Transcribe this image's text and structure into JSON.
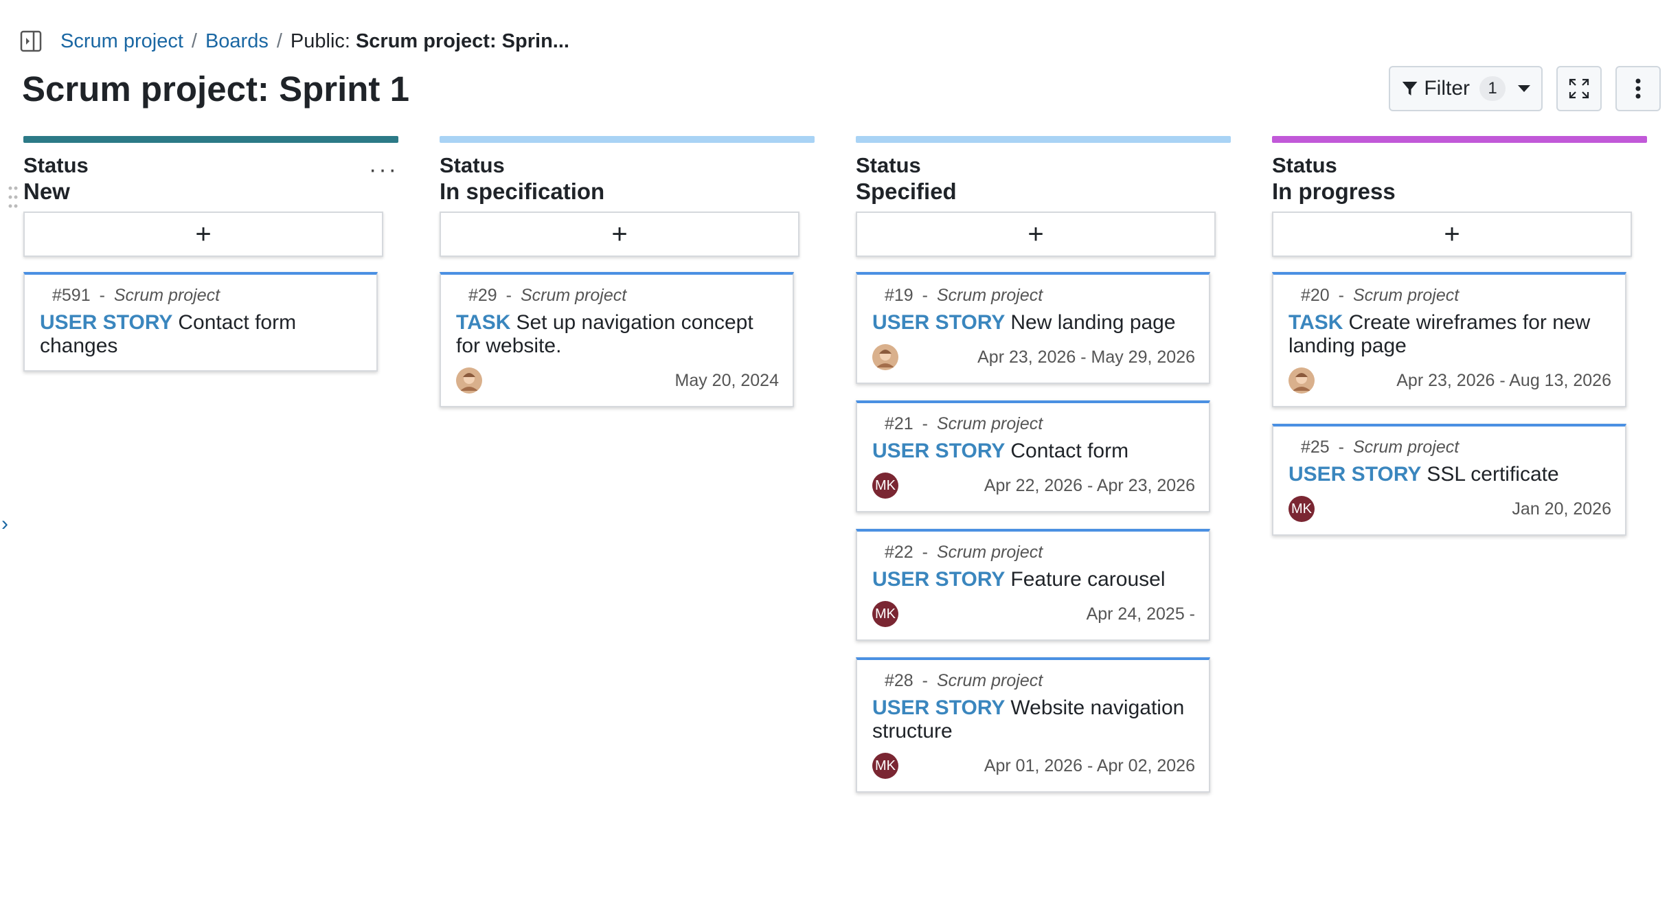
{
  "breadcrumb": {
    "project": "Scrum project",
    "sep1": "/",
    "boards": "Boards",
    "sep2": "/",
    "public_prefix": "Public:",
    "current": "Scrum project: Sprin..."
  },
  "page": {
    "title": "Scrum project: Sprint 1"
  },
  "toolbar": {
    "filter_label": "Filter",
    "filter_count": "1"
  },
  "side_chevron": "›",
  "columns": [
    {
      "status_label": "Status",
      "name": "New",
      "color": "#2c7a87",
      "add_label": "+",
      "menu_label": "···",
      "cards": [
        {
          "id": "#591",
          "sep": "-",
          "project": "Scrum project",
          "type": "USER STORY",
          "title": "Contact form changes",
          "date": "",
          "avatar": ""
        }
      ]
    },
    {
      "status_label": "Status",
      "name": "In specification",
      "color": "#a9d3f5",
      "add_label": "+",
      "cards": [
        {
          "id": "#29",
          "sep": "-",
          "project": "Scrum project",
          "type": "TASK",
          "title": "Set up navigation concept for website.",
          "date": "May 20, 2024",
          "avatar": "photo"
        }
      ]
    },
    {
      "status_label": "Status",
      "name": "Specified",
      "color": "#a9d3f5",
      "add_label": "+",
      "cards": [
        {
          "id": "#19",
          "sep": "-",
          "project": "Scrum project",
          "type": "USER STORY",
          "title": "New landing page",
          "date": "Apr 23, 2026 - May 29, 2026",
          "avatar": "photo"
        },
        {
          "id": "#21",
          "sep": "-",
          "project": "Scrum project",
          "type": "USER STORY",
          "title": "Contact form",
          "date": "Apr 22, 2026 - Apr 23, 2026",
          "avatar": "MK"
        },
        {
          "id": "#22",
          "sep": "-",
          "project": "Scrum project",
          "type": "USER STORY",
          "title": "Feature carousel",
          "date": "Apr 24, 2025 -",
          "avatar": "MK"
        },
        {
          "id": "#28",
          "sep": "-",
          "project": "Scrum project",
          "type": "USER STORY",
          "title": "Website navigation structure",
          "date": "Apr 01, 2026 - Apr 02, 2026",
          "avatar": "MK"
        }
      ]
    },
    {
      "status_label": "Status",
      "name": "In progress",
      "color": "#c159d8",
      "add_label": "+",
      "cards": [
        {
          "id": "#20",
          "sep": "-",
          "project": "Scrum project",
          "type": "TASK",
          "title": "Create wireframes for new landing page",
          "date": "Apr 23, 2026 - Aug 13, 2026",
          "avatar": "photo"
        },
        {
          "id": "#25",
          "sep": "-",
          "project": "Scrum project",
          "type": "USER STORY",
          "title": "SSL certificate",
          "date": "Jan 20, 2026",
          "avatar": "MK"
        }
      ]
    }
  ]
}
